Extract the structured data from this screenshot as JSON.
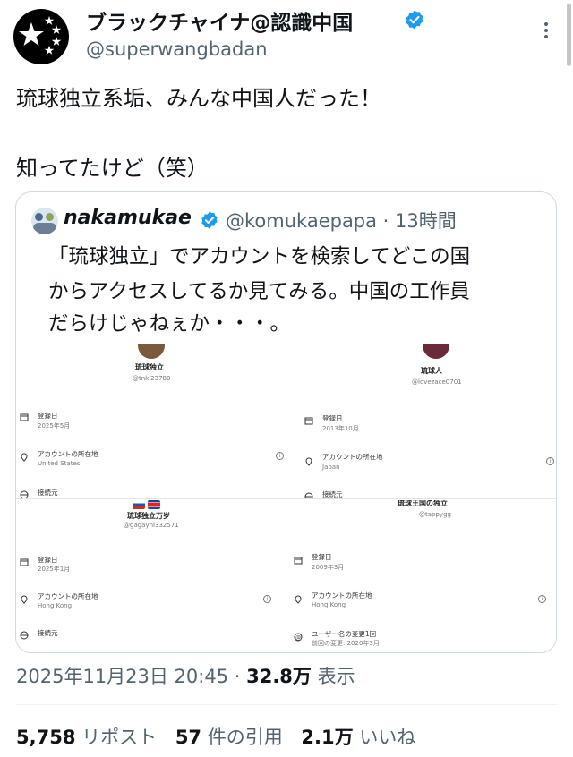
{
  "header": {
    "display_name": "ブラックチャイナ@認識中国",
    "handle": "@superwangbadan",
    "avatar": "black-avatar-with-white-stars",
    "verified": "verified-badge-icon",
    "more": "more-options-icon"
  },
  "tweet": {
    "line1": "琉球独立系垢、みんな中国人だった！",
    "line2": "知ってたけど（笑）"
  },
  "quote": {
    "display_name": "nakamukae",
    "handle_time": "@komukaepapa · 13時間",
    "body": [
      "「琉球独立」でアカウントを検索してどこの国",
      "からアクセスしてるか見てみる。中国の工作員",
      "だらけじゃねぇか・・・。"
    ],
    "panels": [
      {
        "name": "琉球独立",
        "handle": "@tnki23780",
        "joined_label": "登録日",
        "joined_value": "2025年5月",
        "location_label": "アカウントの所在地",
        "location_value": "United States",
        "connect_label": "接続元"
      },
      {
        "name": "琉球人",
        "handle": "@lovezace0701",
        "joined_label": "登録日",
        "joined_value": "2013年10月",
        "location_label": "アカウントの所在地",
        "location_value": "Japan",
        "connect_label": "接続元"
      },
      {
        "name": "琉球独立万岁",
        "handle": "@gagayni332571",
        "joined_label": "登録日",
        "joined_value": "2025年1月",
        "location_label": "アカウントの所在地",
        "location_value": "Hong Kong",
        "connect_label": "接続元"
      },
      {
        "name": "琉球王国の独立",
        "handle": "@tappygg",
        "joined_label": "登録日",
        "joined_value": "2009年3月",
        "location_label": "アカウントの所在地",
        "location_value": "Hong Kong",
        "change_label": "ユーザー名の変更1回",
        "change_value": "前回の変更: 2020年3月"
      }
    ]
  },
  "meta": {
    "timestamp": "2025年11月23日 20:45 · ",
    "views_num": "32.8万",
    "views_label": " 表示"
  },
  "stats": {
    "reposts_num": "5,758",
    "reposts_label": "リポスト",
    "quotes_num": "57",
    "quotes_label": "件の引用",
    "likes_num": "2.1万",
    "likes_label": "いいね"
  },
  "colors": {
    "verified": "#1d9bf0",
    "secondary_text": "#536471",
    "border": "#cfd9de"
  }
}
